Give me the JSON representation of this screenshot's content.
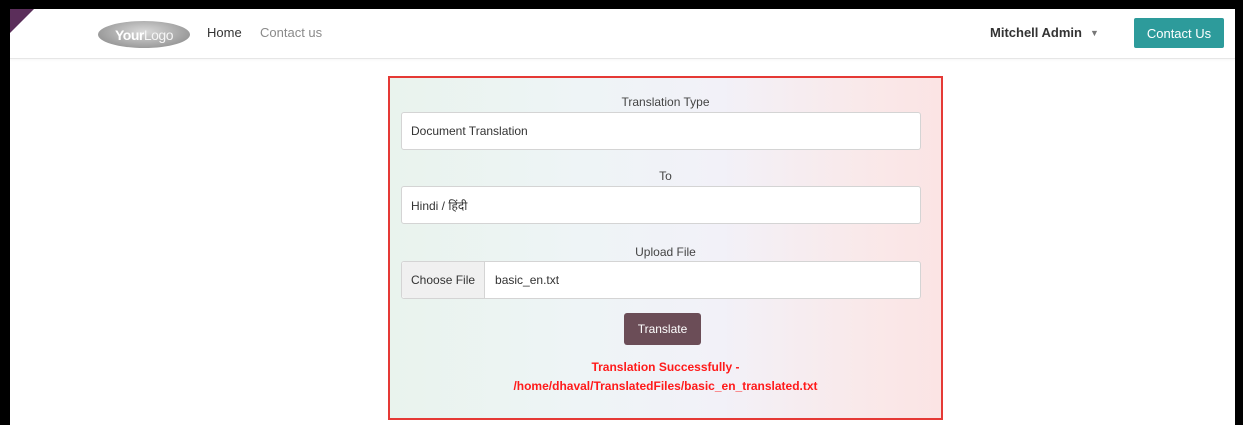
{
  "nav": {
    "logo": {
      "part1": "Your",
      "part2": "Logo"
    },
    "links": [
      "Home",
      "Contact us"
    ],
    "user": "Mitchell Admin",
    "cta": "Contact Us"
  },
  "form": {
    "translation_type": {
      "label": "Translation Type",
      "value": "Document Translation"
    },
    "to": {
      "label": "To",
      "value": "Hindi / हिंदी"
    },
    "upload": {
      "label": "Upload File",
      "button": "Choose File",
      "filename": "basic_en.txt"
    },
    "translate_button": "Translate",
    "message": {
      "line1": "Translation Successfully -",
      "line2": "/home/dhaval/TranslatedFiles/basic_en_translated.txt",
      "color": "#ff1a1a"
    }
  },
  "colors": {
    "accent": "#2d9b9b",
    "panel_border": "#e53935",
    "translate_btn": "#6b4d57"
  }
}
